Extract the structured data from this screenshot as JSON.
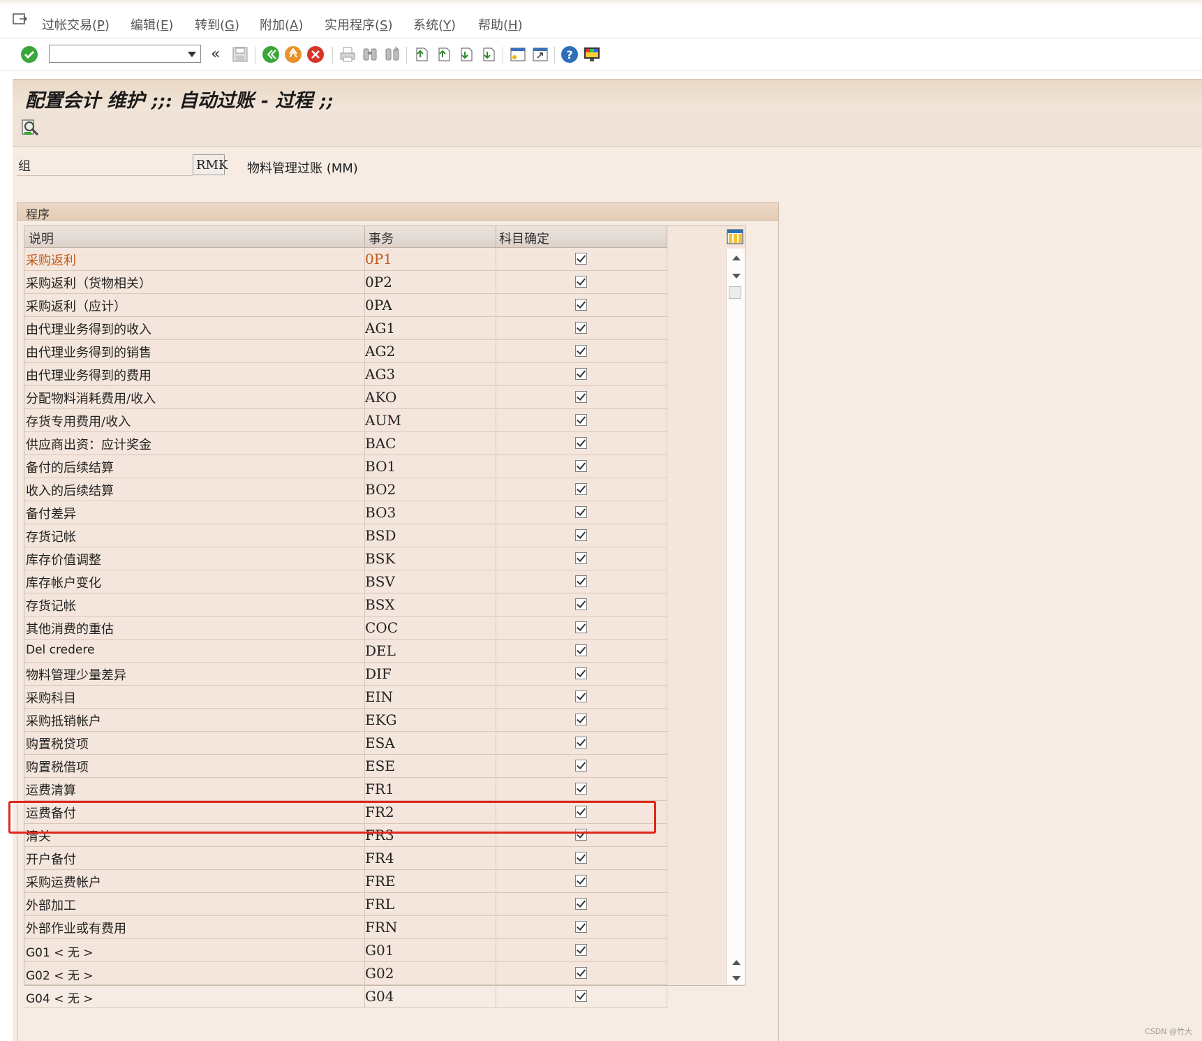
{
  "menubar": {
    "items": [
      {
        "label": "过帐交易(",
        "key": "P"
      },
      {
        "label": "编辑(",
        "key": "E"
      },
      {
        "label": "转到(",
        "key": "G"
      },
      {
        "label": "附加(",
        "key": "A"
      },
      {
        "label": "实用程序(",
        "key": "S"
      },
      {
        "label": "系统(",
        "key": "Y"
      },
      {
        "label": "帮助(",
        "key": "H"
      }
    ],
    "close": ")"
  },
  "toolbar": {
    "command_value": "",
    "back_symbol": "«",
    "colors": {
      "green": "#3aa63a",
      "orange": "#e8922a",
      "red": "#d8352a",
      "blue": "#2d6fb8"
    }
  },
  "title": "配置会计 维护 ;;:  自动过账 - 过程 ;;",
  "group": {
    "label": "组",
    "value": "RMK",
    "description": "物料管理过账 (MM)"
  },
  "procedures": {
    "frame_title": "程序",
    "columns": [
      "说明",
      "事务",
      "科目确定"
    ],
    "rows": [
      {
        "desc": "采购返利",
        "code": "0P1",
        "checked": true,
        "highlight": true
      },
      {
        "desc": "采购返利（货物相关）",
        "code": "0P2",
        "checked": true
      },
      {
        "desc": "采购返利（应计）",
        "code": "0PA",
        "checked": true
      },
      {
        "desc": "由代理业务得到的收入",
        "code": "AG1",
        "checked": true
      },
      {
        "desc": "由代理业务得到的销售",
        "code": "AG2",
        "checked": true
      },
      {
        "desc": "由代理业务得到的费用",
        "code": "AG3",
        "checked": true
      },
      {
        "desc": "分配物料消耗费用/收入",
        "code": "AKO",
        "checked": true
      },
      {
        "desc": "存货专用费用/收入",
        "code": "AUM",
        "checked": true
      },
      {
        "desc": "供应商出资：应计奖金",
        "code": "BAC",
        "checked": true
      },
      {
        "desc": "备付的后续结算",
        "code": "BO1",
        "checked": true
      },
      {
        "desc": "收入的后续结算",
        "code": "BO2",
        "checked": true
      },
      {
        "desc": "备付差异",
        "code": "BO3",
        "checked": true
      },
      {
        "desc": "存货记帐",
        "code": "BSD",
        "checked": true
      },
      {
        "desc": "库存价值调整",
        "code": "BSK",
        "checked": true
      },
      {
        "desc": "库存帐户变化",
        "code": "BSV",
        "checked": true
      },
      {
        "desc": "存货记帐",
        "code": "BSX",
        "checked": true
      },
      {
        "desc": "其他消费的重估",
        "code": "COC",
        "checked": true
      },
      {
        "desc": "Del credere",
        "code": "DEL",
        "checked": true,
        "sans": true
      },
      {
        "desc": "物料管理少量差异",
        "code": "DIF",
        "checked": true
      },
      {
        "desc": "采购科目",
        "code": "EIN",
        "checked": true
      },
      {
        "desc": "采购抵销帐户",
        "code": "EKG",
        "checked": true
      },
      {
        "desc": "购置税贷项",
        "code": "ESA",
        "checked": true
      },
      {
        "desc": "购置税借项",
        "code": "ESE",
        "checked": true
      },
      {
        "desc": "运费清算",
        "code": "FR1",
        "checked": true
      },
      {
        "desc": "运费备付",
        "code": "FR2",
        "checked": true
      },
      {
        "desc": "清关",
        "code": "FR3",
        "checked": true
      },
      {
        "desc": "开户备付",
        "code": "FR4",
        "checked": true
      },
      {
        "desc": "采购运费帐户",
        "code": "FRE",
        "checked": true
      },
      {
        "desc": "外部加工",
        "code": "FRL",
        "checked": true
      },
      {
        "desc": "外部作业或有费用",
        "code": "FRN",
        "checked": true
      },
      {
        "desc": "G01 < 无 >",
        "code": "G01",
        "checked": true,
        "sans": true
      },
      {
        "desc": "G02 < 无 >",
        "code": "G02",
        "checked": true,
        "sans": true
      },
      {
        "desc": "G04 < 无 >",
        "code": "G04",
        "checked": true,
        "sans": true
      }
    ]
  },
  "watermark": "CSDN @竹大"
}
